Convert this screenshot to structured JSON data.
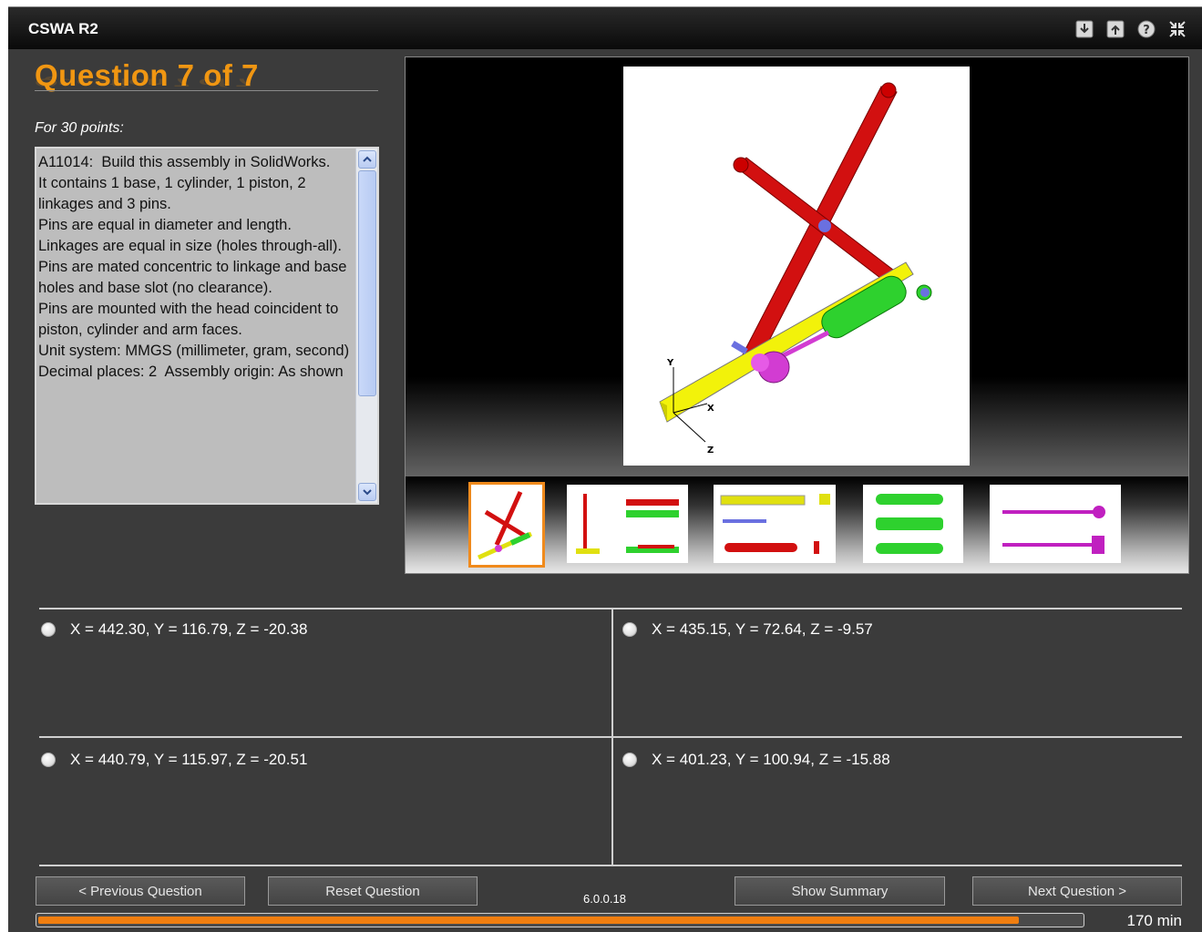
{
  "app": {
    "title": "CSWA R2"
  },
  "titlebar_icons": [
    "download-icon",
    "upload-icon",
    "help-icon",
    "collapse-icon"
  ],
  "question": {
    "title": "Question 7 of 7",
    "points": "For 30 points:",
    "text": "A11014:  Build this assembly in SolidWorks.\nIt contains 1 base, 1 cylinder, 1 piston, 2 linkages and 3 pins.\nPins are equal in diameter and length.\nLinkages are equal in size (holes through-all).\nPins are mated concentric to linkage and base holes and base slot (no clearance).\nPins are mounted with the head coincident to piston, cylinder and arm faces.\nUnit system: MMGS (millimeter, gram, second)\nDecimal places: 2  Assembly origin: As shown"
  },
  "answers": [
    {
      "label": "X = 442.30, Y = 116.79, Z = -20.38"
    },
    {
      "label": "X = 435.15, Y = 72.64, Z = -9.57"
    },
    {
      "label": "X = 440.79, Y = 115.97, Z = -20.51"
    },
    {
      "label": "X = 401.23, Y = 100.94, Z = -15.88"
    }
  ],
  "buttons": {
    "previous": "< Previous Question",
    "reset": "Reset Question",
    "summary": "Show Summary",
    "next": "Next Question >"
  },
  "version": "6.0.0.18",
  "progress": {
    "fraction": 0.94,
    "time_label": "170 min"
  },
  "axes": {
    "x": "X",
    "y": "Y",
    "z": "Z"
  },
  "colors": {
    "accent": "#f09612",
    "progress": "#f07e10",
    "background": "#3b3b3b"
  }
}
